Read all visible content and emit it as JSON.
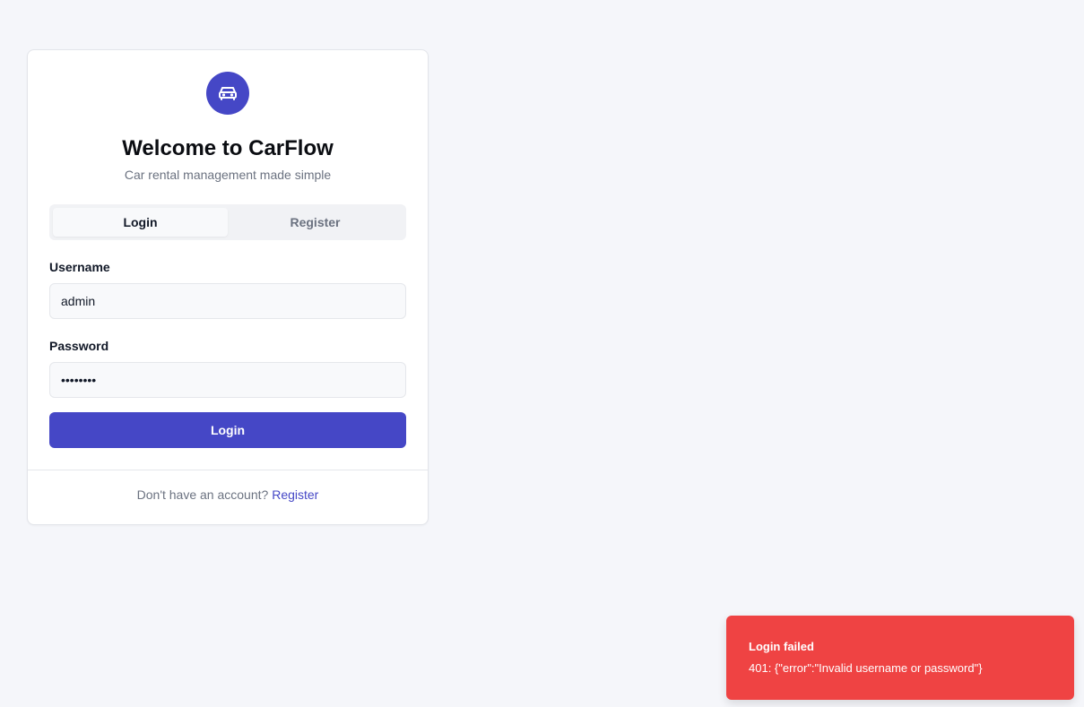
{
  "app": {
    "title": "Welcome to CarFlow",
    "subtitle": "Car rental management made simple",
    "logo_icon": "car-icon",
    "accent_color": "#4547c6"
  },
  "tabs": [
    {
      "label": "Login",
      "active": true
    },
    {
      "label": "Register",
      "active": false
    }
  ],
  "form": {
    "username_label": "Username",
    "username_value": "admin",
    "password_label": "Password",
    "password_value": "password",
    "submit_label": "Login"
  },
  "footer": {
    "prompt": "Don't have an account?",
    "link": "Register"
  },
  "toast": {
    "title": "Login failed",
    "message": "401: {\"error\":\"Invalid username or password\"}",
    "color": "#ef4343"
  }
}
